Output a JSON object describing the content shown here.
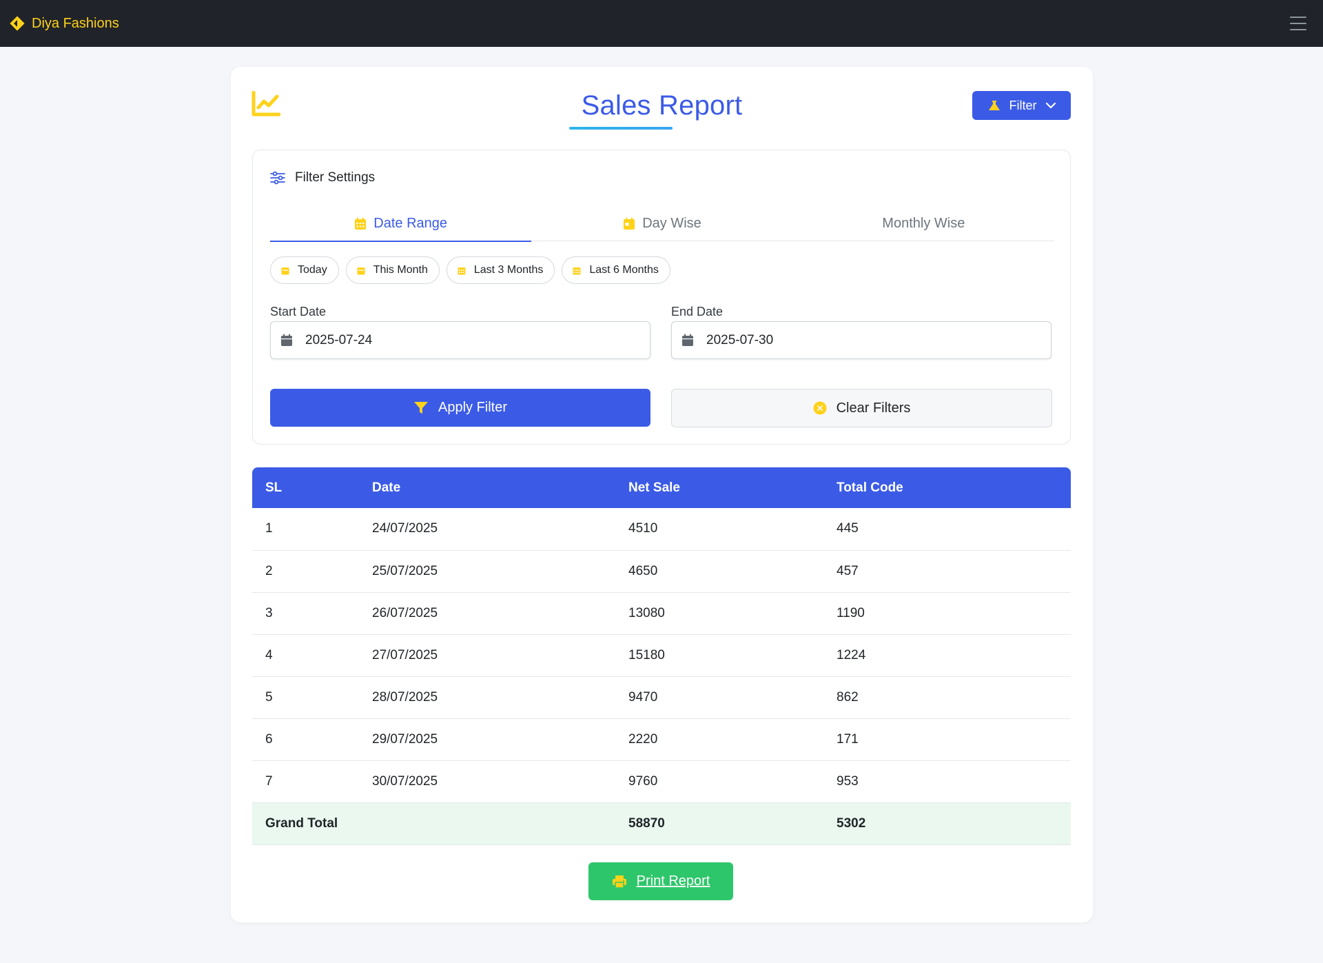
{
  "navbar": {
    "brand": "Diya Fashions",
    "brand_color": "#ffd21a",
    "brand_icon": "diamond-sign-icon",
    "menu_icon": "hamburger-icon"
  },
  "header": {
    "title": "Sales Report",
    "title_icon": "line-chart-icon",
    "filter_button_label": "Filter"
  },
  "filter_panel": {
    "title": "Filter Settings",
    "tabs": [
      {
        "label": "Date Range",
        "icon": "calendar-icon",
        "active": true
      },
      {
        "label": "Day Wise",
        "icon": "calendar-icon",
        "active": false
      },
      {
        "label": "Monthly Wise",
        "icon": "",
        "active": false
      }
    ],
    "quick_ranges": [
      "Today",
      "This Month",
      "Last 3 Months",
      "Last 6 Months"
    ],
    "start_date": {
      "label": "Start Date",
      "value": "2025-07-24"
    },
    "end_date": {
      "label": "End Date",
      "value": "2025-07-30"
    },
    "apply_label": "Apply Filter",
    "clear_label": "Clear Filters"
  },
  "table": {
    "columns": [
      "SL",
      "Date",
      "Net Sale",
      "Total Code"
    ],
    "rows": [
      [
        "1",
        "24/07/2025",
        "4510",
        "445"
      ],
      [
        "2",
        "25/07/2025",
        "4650",
        "457"
      ],
      [
        "3",
        "26/07/2025",
        "13080",
        "1190"
      ],
      [
        "4",
        "27/07/2025",
        "15180",
        "1224"
      ],
      [
        "5",
        "28/07/2025",
        "9470",
        "862"
      ],
      [
        "6",
        "29/07/2025",
        "2220",
        "171"
      ],
      [
        "7",
        "30/07/2025",
        "9760",
        "953"
      ]
    ],
    "total": {
      "label": "Grand Total",
      "net_sale": "58870",
      "total_code": "5302"
    }
  },
  "print_label": "Print Report",
  "colors": {
    "primary": "#3b5be6",
    "accent_yellow": "#ffd21a",
    "success": "#2ec66a",
    "navbar_bg": "#202329",
    "total_row_bg": "#eaf8f0"
  }
}
